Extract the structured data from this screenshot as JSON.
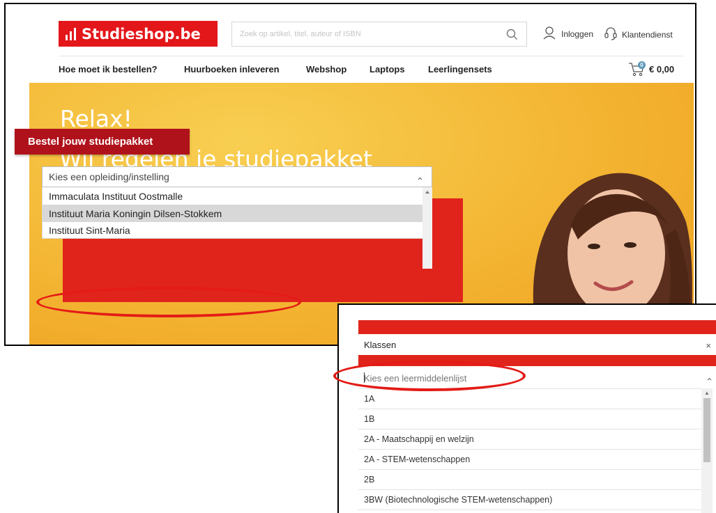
{
  "header": {
    "logo_text": "Studieshop.be",
    "search_placeholder": "Zoek op artikel, titel, auteur of ISBN",
    "login_label": "Inloggen",
    "service_label": "Klantendienst"
  },
  "nav": {
    "items": [
      "Hoe moet ik bestellen?",
      "Huurboeken inleveren",
      "Webshop",
      "Laptops",
      "Leerlingensets"
    ],
    "cart_total": "€ 0,00",
    "cart_count": "0"
  },
  "hero": {
    "line1": "Relax!",
    "line2": "Wij regelen je studiepakket"
  },
  "order": {
    "tab_label": "Bestel jouw studiepakket",
    "select_placeholder": "Kies een opleiding/instelling",
    "options": [
      "Immaculata Instituut Oostmalle",
      "Instituut Maria Koningin Dilsen-Stokkem",
      "Instituut Sint-Maria"
    ],
    "highlighted_index": 1
  },
  "klassen": {
    "title": "Klassen",
    "close": "×",
    "select_placeholder": "Kies een leermiddelenlijst",
    "options": [
      "1A",
      "1B",
      "2A - Maatschappij en welzijn",
      "2A - STEM-wetenschappen",
      "2B",
      "3BW (Biotechnologische STEM-wetenschappen)"
    ]
  },
  "colors": {
    "brand_red": "#e3161a",
    "dark_red": "#b0121b",
    "hero_yellow": "#f4b836",
    "highlight_ring": "#e41b16"
  }
}
